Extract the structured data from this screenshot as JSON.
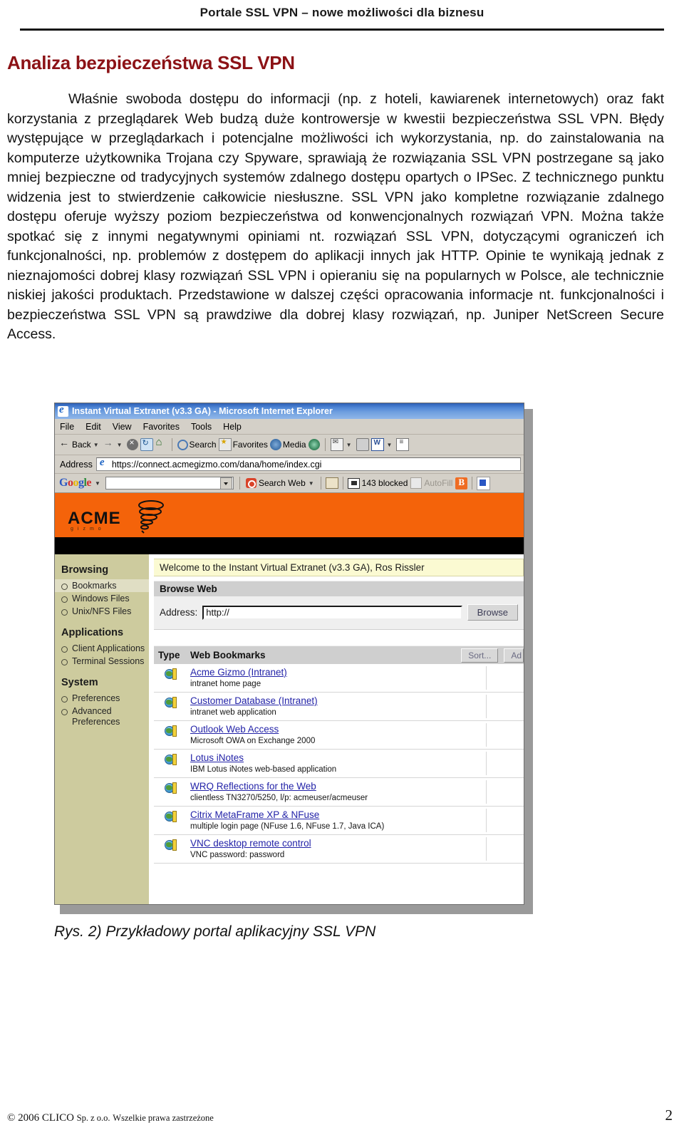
{
  "running_head": "Portale SSL VPN – nowe możliwości dla biznesu",
  "section_title": "Analiza bezpieczeństwa SSL VPN",
  "body_paragraph": "Właśnie swoboda dostępu do informacji (np. z hoteli, kawiarenek internetowych) oraz fakt korzystania z przeglądarek Web budzą duże kontrowersje w kwestii bezpieczeństwa SSL VPN. Błędy występujące w przeglądarkach i potencjalne możliwości ich wykorzystania, np. do zainstalowania na komputerze użytkownika Trojana czy Spyware, sprawiają że rozwiązania SSL VPN postrzegane są jako mniej bezpieczne od tradycyjnych systemów zdalnego dostępu opartych o IPSec. Z technicznego punktu widzenia jest to stwierdzenie całkowicie niesłuszne. SSL VPN jako kompletne rozwiązanie zdalnego dostępu oferuje wyższy poziom bezpieczeństwa od konwencjonalnych rozwiązań VPN. Można także spotkać się z innymi negatywnymi opiniami nt. rozwiązań SSL VPN, dotyczącymi ograniczeń ich funkcjonalności, np. problemów z dostępem do aplikacji innych jak HTTP. Opinie te wynikają jednak z nieznajomości dobrej klasy rozwiązań SSL VPN i opieraniu się na popularnych w Polsce, ale technicznie niskiej jakości produktach. Przedstawione w dalszej części opracowania informacje nt. funkcjonalności i bezpieczeństwa SSL VPN są prawdziwe dla dobrej klasy rozwiązań, np. Juniper NetScreen Secure Access.",
  "figure": {
    "caption": "Rys. 2) Przykładowy portal aplikacyjny SSL VPN",
    "browser": {
      "title": "Instant Virtual Extranet (v3.3 GA) - Microsoft Internet Explorer",
      "menu": [
        "File",
        "Edit",
        "View",
        "Favorites",
        "Tools",
        "Help"
      ],
      "toolbar": {
        "back": "Back",
        "search": "Search",
        "favorites": "Favorites",
        "media": "Media"
      },
      "address": {
        "label": "Address",
        "value": "https://connect.acmegizmo.com/dana/home/index.cgi"
      },
      "google_toolbar": {
        "logo": "Google",
        "query": "",
        "search_web": "Search Web",
        "blocked": "143 blocked",
        "autofill": "AutoFill"
      }
    },
    "portal": {
      "brand": {
        "name": "ACME",
        "sub": "gizmo",
        "banner_color": "#f4630a"
      },
      "sidebar": [
        {
          "type": "heading",
          "label": "Browsing"
        },
        {
          "type": "link",
          "label": "Bookmarks",
          "active": true
        },
        {
          "type": "link",
          "label": "Windows Files",
          "active": false
        },
        {
          "type": "link",
          "label": "Unix/NFS Files",
          "active": false
        },
        {
          "type": "heading",
          "label": "Applications"
        },
        {
          "type": "link",
          "label": "Client Applications",
          "active": false
        },
        {
          "type": "link",
          "label": "Terminal Sessions",
          "active": false
        },
        {
          "type": "heading",
          "label": "System"
        },
        {
          "type": "link",
          "label": "Preferences",
          "active": false
        },
        {
          "type": "link",
          "label": "Advanced Preferences",
          "active": false
        }
      ],
      "welcome": "Welcome to the Instant Virtual Extranet (v3.3 GA), Ros Rissler",
      "browse_web": {
        "heading": "Browse Web",
        "address_label": "Address:",
        "address_value": "http://",
        "browse_button": "Browse"
      },
      "bookmarks_table": {
        "col_type": "Type",
        "col_name": "Web Bookmarks",
        "sort_button": "Sort...",
        "add_button": "Ad",
        "rows": [
          {
            "name": "Acme Gizmo (Intranet)",
            "desc": "intranet home page"
          },
          {
            "name": "Customer Database (Intranet)",
            "desc": "intranet web application"
          },
          {
            "name": "Outlook Web Access",
            "desc": "Microsoft OWA on Exchange 2000"
          },
          {
            "name": "Lotus iNotes",
            "desc": "IBM Lotus iNotes web-based application"
          },
          {
            "name": "WRQ Reflections for the Web",
            "desc": "clientless TN3270/5250, l/p: acmeuser/acmeuser"
          },
          {
            "name": "Citrix MetaFrame XP & NFuse",
            "desc": "multiple login page (NFuse 1.6, NFuse 1.7, Java ICA)"
          },
          {
            "name": "VNC desktop remote control",
            "desc": "VNC password: password"
          }
        ]
      }
    }
  },
  "footer": {
    "copyright_symbol": "©",
    "copyright": "2006 CLICO",
    "company_sc": "Sp. z o.o.",
    "rights_sc": "Wszelkie prawa zastrzeżone",
    "page_number": "2"
  }
}
